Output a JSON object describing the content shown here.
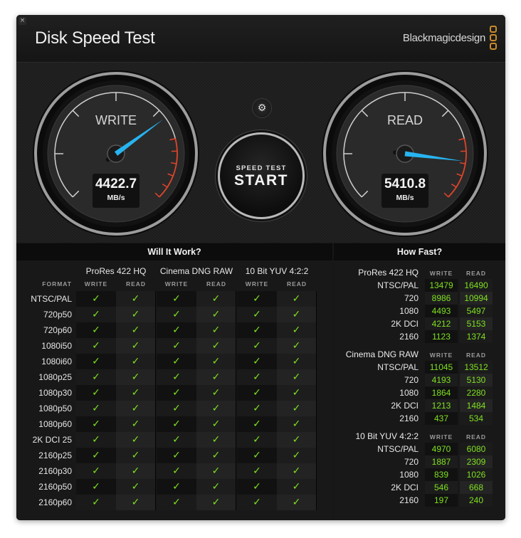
{
  "window": {
    "title": "Disk Speed Test",
    "brand": "Blackmagicdesign",
    "close_icon": "close-icon"
  },
  "gauges": {
    "write": {
      "label": "WRITE",
      "value": "4422.7",
      "unit": "MB/s",
      "needle_fraction": 0.7
    },
    "read": {
      "label": "READ",
      "value": "5410.8",
      "unit": "MB/s",
      "needle_fraction": 0.86
    },
    "needle_color": "#27b4f0",
    "redline_color": "#e0452a"
  },
  "controls": {
    "settings_icon": "gear-icon",
    "start_sub": "SPEED TEST",
    "start_main": "START"
  },
  "will_it_work": {
    "title": "Will It Work?",
    "format_header": "FORMAT",
    "groups": [
      "ProRes 422 HQ",
      "Cinema DNG RAW",
      "10 Bit YUV 4:2:2"
    ],
    "subheaders": [
      "WRITE",
      "READ",
      "WRITE",
      "READ",
      "WRITE",
      "READ"
    ],
    "check_color": "#7fe020",
    "rows": [
      {
        "format": "NTSC/PAL",
        "checks": [
          true,
          true,
          true,
          true,
          true,
          true
        ]
      },
      {
        "format": "720p50",
        "checks": [
          true,
          true,
          true,
          true,
          true,
          true
        ]
      },
      {
        "format": "720p60",
        "checks": [
          true,
          true,
          true,
          true,
          true,
          true
        ]
      },
      {
        "format": "1080i50",
        "checks": [
          true,
          true,
          true,
          true,
          true,
          true
        ]
      },
      {
        "format": "1080i60",
        "checks": [
          true,
          true,
          true,
          true,
          true,
          true
        ]
      },
      {
        "format": "1080p25",
        "checks": [
          true,
          true,
          true,
          true,
          true,
          true
        ]
      },
      {
        "format": "1080p30",
        "checks": [
          true,
          true,
          true,
          true,
          true,
          true
        ]
      },
      {
        "format": "1080p50",
        "checks": [
          true,
          true,
          true,
          true,
          true,
          true
        ]
      },
      {
        "format": "1080p60",
        "checks": [
          true,
          true,
          true,
          true,
          true,
          true
        ]
      },
      {
        "format": "2K DCI 25",
        "checks": [
          true,
          true,
          true,
          true,
          true,
          true
        ]
      },
      {
        "format": "2160p25",
        "checks": [
          true,
          true,
          true,
          true,
          true,
          true
        ]
      },
      {
        "format": "2160p30",
        "checks": [
          true,
          true,
          true,
          true,
          true,
          true
        ]
      },
      {
        "format": "2160p50",
        "checks": [
          true,
          true,
          true,
          true,
          true,
          true
        ]
      },
      {
        "format": "2160p60",
        "checks": [
          true,
          true,
          true,
          true,
          true,
          true
        ]
      }
    ]
  },
  "how_fast": {
    "title": "How Fast?",
    "write_header": "WRITE",
    "read_header": "READ",
    "sections": [
      {
        "name": "ProRes 422 HQ",
        "rows": [
          {
            "label": "NTSC/PAL",
            "write": "13479",
            "read": "16490"
          },
          {
            "label": "720",
            "write": "8986",
            "read": "10994"
          },
          {
            "label": "1080",
            "write": "4493",
            "read": "5497"
          },
          {
            "label": "2K DCI",
            "write": "4212",
            "read": "5153"
          },
          {
            "label": "2160",
            "write": "1123",
            "read": "1374"
          }
        ]
      },
      {
        "name": "Cinema DNG RAW",
        "rows": [
          {
            "label": "NTSC/PAL",
            "write": "11045",
            "read": "13512"
          },
          {
            "label": "720",
            "write": "4193",
            "read": "5130"
          },
          {
            "label": "1080",
            "write": "1864",
            "read": "2280"
          },
          {
            "label": "2K DCI",
            "write": "1213",
            "read": "1484"
          },
          {
            "label": "2160",
            "write": "437",
            "read": "534"
          }
        ]
      },
      {
        "name": "10 Bit YUV 4:2:2",
        "rows": [
          {
            "label": "NTSC/PAL",
            "write": "4970",
            "read": "6080"
          },
          {
            "label": "720",
            "write": "1887",
            "read": "2309"
          },
          {
            "label": "1080",
            "write": "839",
            "read": "1026"
          },
          {
            "label": "2K DCI",
            "write": "546",
            "read": "668"
          },
          {
            "label": "2160",
            "write": "197",
            "read": "240"
          }
        ]
      }
    ]
  }
}
